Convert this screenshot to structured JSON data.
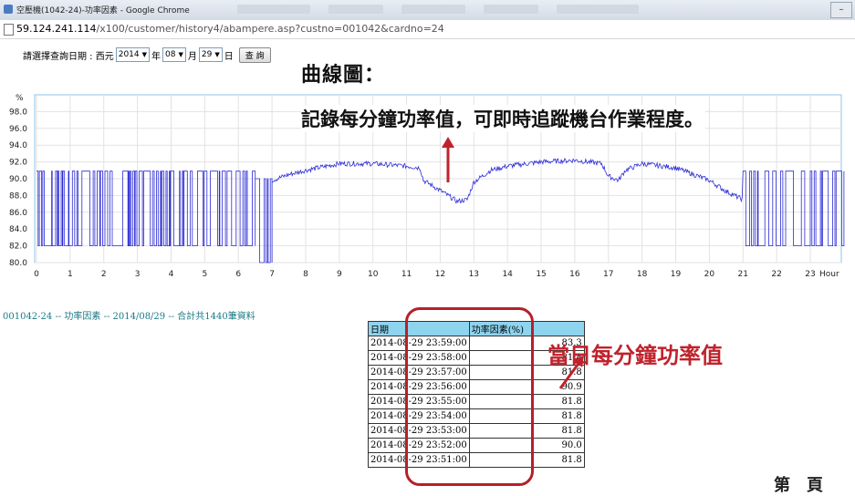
{
  "window": {
    "title": "空壓機(1042-24)-功率因素 - Google Chrome",
    "url_host": "59.124.241.114",
    "url_path": "/x100/customer/history4/abampere.asp?custno=001042&cardno=24"
  },
  "query": {
    "prompt": "請選擇查詢日期 : 西元",
    "year": "2014",
    "year_unit": "年",
    "month": "08",
    "month_unit": "月",
    "day": "29",
    "day_unit": "日",
    "button": "查 詢"
  },
  "annotations": {
    "chart_title": "曲線圖：",
    "chart_desc": "記錄每分鐘功率值，可即時追蹤機台作業程度。",
    "table_note": "當日每分鐘功率值",
    "page_label": "第　頁",
    "accent_color": "#c0222c"
  },
  "caption": "001042-24 -- 功率因素 -- 2014/08/29 -- 合計共1440筆資料",
  "chart_data": {
    "type": "line",
    "ylabel": "%",
    "xlabel": "Hour",
    "ylim": [
      80.0,
      100.0
    ],
    "yticks": [
      "98.0",
      "96.0",
      "94.0",
      "92.0",
      "90.0",
      "88.0",
      "86.0",
      "84.0",
      "82.0",
      "80.0"
    ],
    "xlim": [
      0,
      24
    ],
    "xticks": [
      "0",
      "1",
      "2",
      "3",
      "4",
      "5",
      "6",
      "7",
      "8",
      "9",
      "10",
      "11",
      "12",
      "13",
      "14",
      "15",
      "16",
      "17",
      "18",
      "19",
      "20",
      "21",
      "22",
      "23"
    ],
    "grid": true,
    "line_color": "#2b2bd6",
    "series": [
      {
        "segments": [
          {
            "x_start": 0.0,
            "x_end": 6.5,
            "pattern": "oscillating",
            "low": 82.0,
            "high": 90.9
          },
          {
            "x_start": 6.5,
            "x_end": 7.0,
            "pattern": "oscillating",
            "low": 80.0,
            "high": 90.0
          },
          {
            "x_start": 7.0,
            "x_end": 21.0,
            "pattern": "smooth",
            "points": [
              [
                7.0,
                89.8
              ],
              [
                7.5,
                90.5
              ],
              [
                8.0,
                91.0
              ],
              [
                9.0,
                91.8
              ],
              [
                10.0,
                91.8
              ],
              [
                11.0,
                91.5
              ],
              [
                11.4,
                91.3
              ],
              [
                11.5,
                89.8
              ],
              [
                12.0,
                88.6
              ],
              [
                12.5,
                87.3
              ],
              [
                12.8,
                87.5
              ],
              [
                13.0,
                89.6
              ],
              [
                13.5,
                91.0
              ],
              [
                14.0,
                91.5
              ],
              [
                15.0,
                92.0
              ],
              [
                16.0,
                92.2
              ],
              [
                16.8,
                91.8
              ],
              [
                17.0,
                90.3
              ],
              [
                17.3,
                89.8
              ],
              [
                17.5,
                91.0
              ],
              [
                18.0,
                91.8
              ],
              [
                19.0,
                91.3
              ],
              [
                20.0,
                89.8
              ],
              [
                20.5,
                88.5
              ],
              [
                21.0,
                87.5
              ]
            ]
          },
          {
            "x_start": 21.0,
            "x_end": 24.0,
            "pattern": "oscillating",
            "low": 82.0,
            "high": 90.9
          }
        ]
      }
    ]
  },
  "table": {
    "headers": [
      "日期",
      "功率因素(%)"
    ],
    "rows": [
      [
        "2014-08-29 23:59:00",
        "83.3"
      ],
      [
        "2014-08-29 23:58:00",
        "81.8"
      ],
      [
        "2014-08-29 23:57:00",
        "81.8"
      ],
      [
        "2014-08-29 23:56:00",
        "90.9"
      ],
      [
        "2014-08-29 23:55:00",
        "81.8"
      ],
      [
        "2014-08-29 23:54:00",
        "81.8"
      ],
      [
        "2014-08-29 23:53:00",
        "81.8"
      ],
      [
        "2014-08-29 23:52:00",
        "90.0"
      ],
      [
        "2014-08-29 23:51:00",
        "81.8"
      ]
    ]
  }
}
